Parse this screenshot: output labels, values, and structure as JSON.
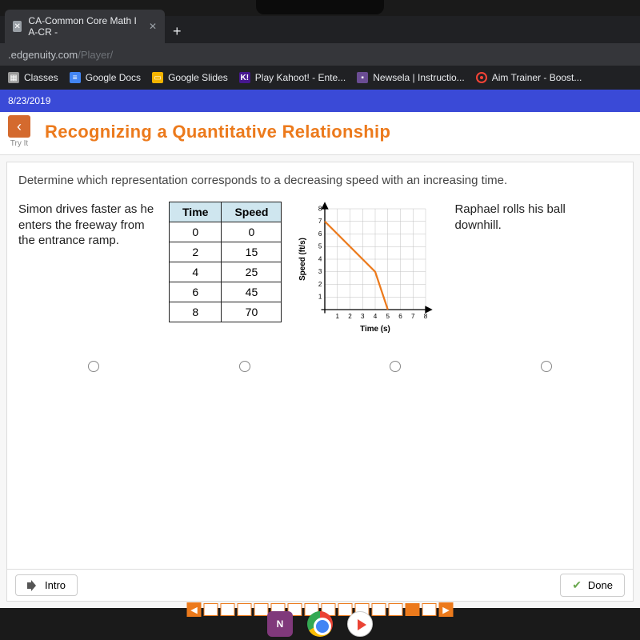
{
  "browser": {
    "tab_title": "CA-Common Core Math I A-CR -",
    "url_host": ".edgenuity.com",
    "url_path": "/Player/",
    "bookmarks": [
      {
        "label": "Classes"
      },
      {
        "label": "Google Docs"
      },
      {
        "label": "Google Slides"
      },
      {
        "label": "Play Kahoot! - Ente..."
      },
      {
        "label": "Newsela | Instructio..."
      },
      {
        "label": "Aim Trainer - Boost..."
      }
    ]
  },
  "header": {
    "date": "8/23/2019",
    "tryit": "Try It",
    "lesson_title": "Recognizing a Quantitative Relationship"
  },
  "question": "Determine which representation corresponds to a decreasing speed with an increasing time.",
  "scenario_left": "Simon drives faster as he enters the freeway from the entrance ramp.",
  "scenario_right": "Raphael rolls his ball downhill.",
  "table": {
    "cols": [
      "Time",
      "Speed"
    ],
    "rows": [
      [
        "0",
        "0"
      ],
      [
        "2",
        "15"
      ],
      [
        "4",
        "25"
      ],
      [
        "6",
        "45"
      ],
      [
        "8",
        "70"
      ]
    ]
  },
  "chart_data": {
    "type": "line",
    "title": "",
    "xlabel": "Time (s)",
    "ylabel": "Speed (ft/s)",
    "xlim": [
      0,
      8
    ],
    "ylim": [
      0,
      8
    ],
    "xticks": [
      1,
      2,
      3,
      4,
      5,
      6,
      7,
      8
    ],
    "yticks": [
      1,
      2,
      3,
      4,
      5,
      6,
      7,
      8
    ],
    "series": [
      {
        "name": "speed",
        "x": [
          0,
          4,
          5
        ],
        "y": [
          7,
          3,
          0
        ]
      }
    ]
  },
  "footer": {
    "intro": "Intro",
    "done": "Done"
  },
  "progress": {
    "count": 14,
    "current": 13
  }
}
